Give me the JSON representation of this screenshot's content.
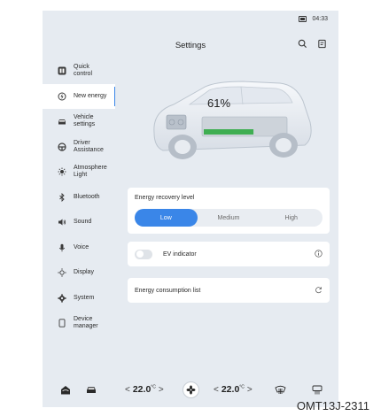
{
  "status": {
    "time": "04:33",
    "battery_icon": "battery-icon"
  },
  "header": {
    "title": "Settings",
    "search_icon": "search-icon",
    "notes_icon": "notes-icon"
  },
  "sidebar": {
    "items": [
      {
        "label": "Quick\ncontrol",
        "icon": "quick-control-icon"
      },
      {
        "label": "New energy",
        "icon": "new-energy-icon",
        "active": true
      },
      {
        "label": "Vehicle\nsettings",
        "icon": "car-icon"
      },
      {
        "label": "Driver\nAssistance",
        "icon": "steering-wheel-icon"
      },
      {
        "label": "Atmosphere\nLight",
        "icon": "light-icon"
      },
      {
        "label": "Bluetooth",
        "icon": "bluetooth-icon"
      },
      {
        "label": "Sound",
        "icon": "speaker-icon"
      },
      {
        "label": "Voice",
        "icon": "microphone-icon"
      },
      {
        "label": "Display",
        "icon": "brightness-icon"
      },
      {
        "label": "System",
        "icon": "gear-icon"
      },
      {
        "label": "Device\nmanager",
        "icon": "device-icon"
      }
    ]
  },
  "vehicle": {
    "battery_percent": "61%",
    "battery_level": 0.61
  },
  "energy_recovery": {
    "title": "Energy recovery level",
    "options": [
      "Low",
      "Medium",
      "High"
    ],
    "selected": "Low"
  },
  "ev_indicator": {
    "label": "EV indicator",
    "enabled": false
  },
  "consumption": {
    "label": "Energy consumption list"
  },
  "bottom_bar": {
    "left_temp": "22.0",
    "right_temp": "22.0",
    "temp_unit": "°C",
    "left_chevron": "<",
    "right_chevron": ">"
  },
  "caption": "OMT13J-2311",
  "colors": {
    "accent": "#3a86e8",
    "battery_green": "#3fae52",
    "background": "#e6ebf1"
  }
}
